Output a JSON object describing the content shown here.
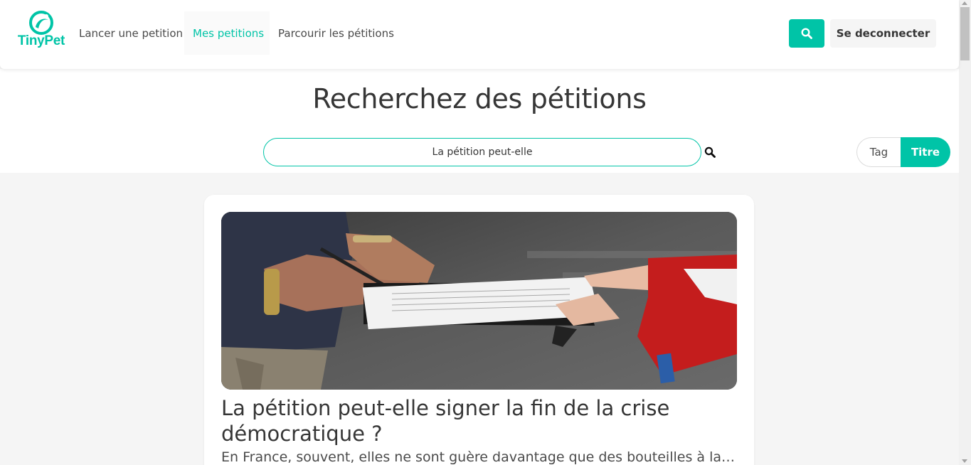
{
  "colors": {
    "accent": "#00c4a7",
    "text": "#363636",
    "background": "#f5f5f5"
  },
  "navbar": {
    "logo_text": "TinyPet",
    "items": [
      {
        "label": "Lancer une petition",
        "active": false
      },
      {
        "label": "Mes petitions",
        "active": true
      },
      {
        "label": "Parcourir les pétitions",
        "active": false
      }
    ],
    "search_icon": "search-icon",
    "logout_label": "Se deconnecter"
  },
  "hero": {
    "title": "Recherchez des pétitions",
    "search_value": "La pétition peut-elle",
    "search_icon": "search-icon",
    "toggle": {
      "tag_label": "Tag",
      "title_label": "Titre",
      "selected": "Titre"
    }
  },
  "results": [
    {
      "title": "La pétition peut-elle signer la fin de la crise démocratique ?",
      "excerpt": "En France, souvent, elles ne sont guère davantage que des bouteilles à la mer jetées"
    }
  ]
}
